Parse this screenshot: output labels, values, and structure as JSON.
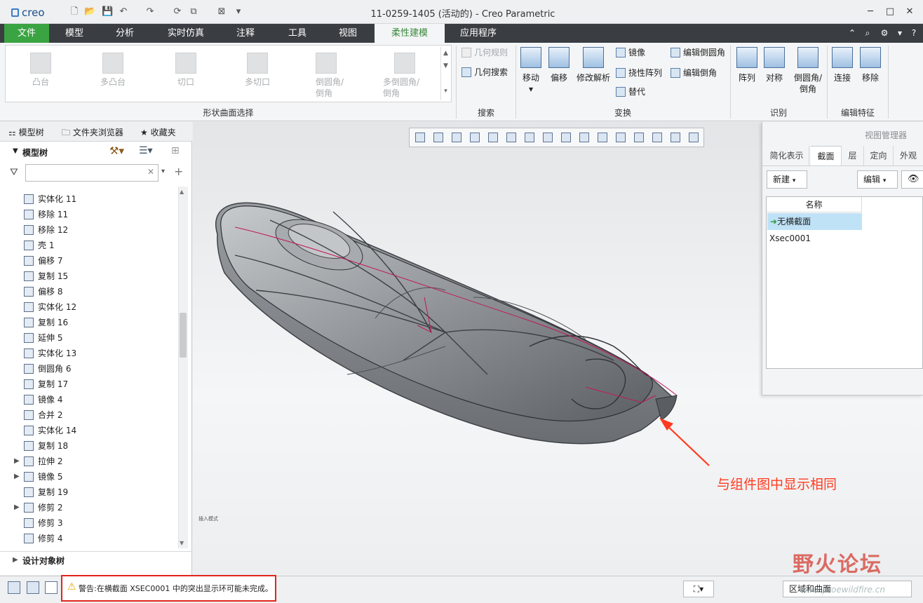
{
  "app": {
    "logo": "creo",
    "window_title": "11-0259-1405 (活动的) - Creo Parametric"
  },
  "quick_access": {
    "icons": [
      "new-icon",
      "open-icon",
      "save-icon",
      "undo-icon",
      "redo-icon",
      "regenerate-icon",
      "windows-icon",
      "close-icon",
      "customize-icon"
    ]
  },
  "window_controls": {
    "minimize": "─",
    "maximize": "□",
    "close": "✕"
  },
  "tabs": [
    {
      "label": "文件"
    },
    {
      "label": "模型"
    },
    {
      "label": "分析"
    },
    {
      "label": "实时仿真"
    },
    {
      "label": "注释"
    },
    {
      "label": "工具"
    },
    {
      "label": "视图"
    },
    {
      "label": "柔性建模"
    },
    {
      "label": "应用程序"
    }
  ],
  "ribbon": {
    "gallery": {
      "items": [
        {
          "label": "凸台"
        },
        {
          "label": "多凸台"
        },
        {
          "label": "切口"
        },
        {
          "label": "多切口"
        },
        {
          "label": "倒圆角/\n倒角"
        },
        {
          "label": "多倒圆角/\n倒角"
        }
      ],
      "group_label": "形状曲面选择"
    },
    "search": {
      "geom_rules": "几何规则",
      "geom_search": "几何搜索",
      "group_label": "搜索"
    },
    "transform": {
      "move": "移动",
      "offset": "偏移",
      "modify_analysis": "修改解析",
      "mirror": "镜像",
      "flex_pattern": "挠性阵列",
      "substitute": "替代",
      "edit_round": "编辑倒圆角",
      "edit_chamfer": "编辑倒角",
      "group_label": "变换"
    },
    "recognize": {
      "pattern": "阵列",
      "symmetry": "对称",
      "round_chamfer": "倒圆角/\n倒角",
      "group_label": "识别"
    },
    "edit_features": {
      "attach": "连接",
      "remove": "移除",
      "group_label": "编辑特征"
    }
  },
  "left_panel": {
    "tabs": [
      {
        "label": "模型树"
      },
      {
        "label": "文件夹浏览器"
      },
      {
        "label": "收藏夹"
      }
    ],
    "tree_title": "模型树",
    "filter_placeholder": "",
    "items": [
      {
        "label": "实体化 11"
      },
      {
        "label": "移除 11"
      },
      {
        "label": "移除 12"
      },
      {
        "label": "壳 1"
      },
      {
        "label": "偏移 7"
      },
      {
        "label": "复制 15"
      },
      {
        "label": "偏移 8"
      },
      {
        "label": "实体化 12"
      },
      {
        "label": "复制 16"
      },
      {
        "label": "延伸 5"
      },
      {
        "label": "实体化 13"
      },
      {
        "label": "倒圆角 6"
      },
      {
        "label": "复制 17"
      },
      {
        "label": "镜像 4"
      },
      {
        "label": "合并 2"
      },
      {
        "label": "实体化 14"
      },
      {
        "label": "复制 18"
      },
      {
        "label": "拉伸 2"
      },
      {
        "label": "镜像 5"
      },
      {
        "label": "复制 19"
      },
      {
        "label": "修剪 2"
      },
      {
        "label": "修剪 3"
      },
      {
        "label": "修剪 4"
      }
    ],
    "design_tree": "设计对象树"
  },
  "viewport": {
    "annotation": "与组件图中显示相同",
    "insert_mode": "插入模式",
    "model_color": "#8f9397",
    "accent_line_color": "#c2185b"
  },
  "view_manager": {
    "title": "视图管理器",
    "tabs": [
      {
        "label": "简化表示"
      },
      {
        "label": "截面"
      },
      {
        "label": "层"
      },
      {
        "label": "定向"
      },
      {
        "label": "外观"
      }
    ],
    "new_button": "新建",
    "edit_button": "编辑",
    "column_header": "名称",
    "rows": [
      {
        "label": "无横截面"
      },
      {
        "label": "Xsec0001"
      }
    ]
  },
  "status": {
    "warning": "警告:在横截面 XSEC0001 中的突出显示环可能未完成。",
    "filter": "区域和曲面"
  },
  "watermark": {
    "text": "野火论坛",
    "url": "www.proewildfire.cn"
  }
}
